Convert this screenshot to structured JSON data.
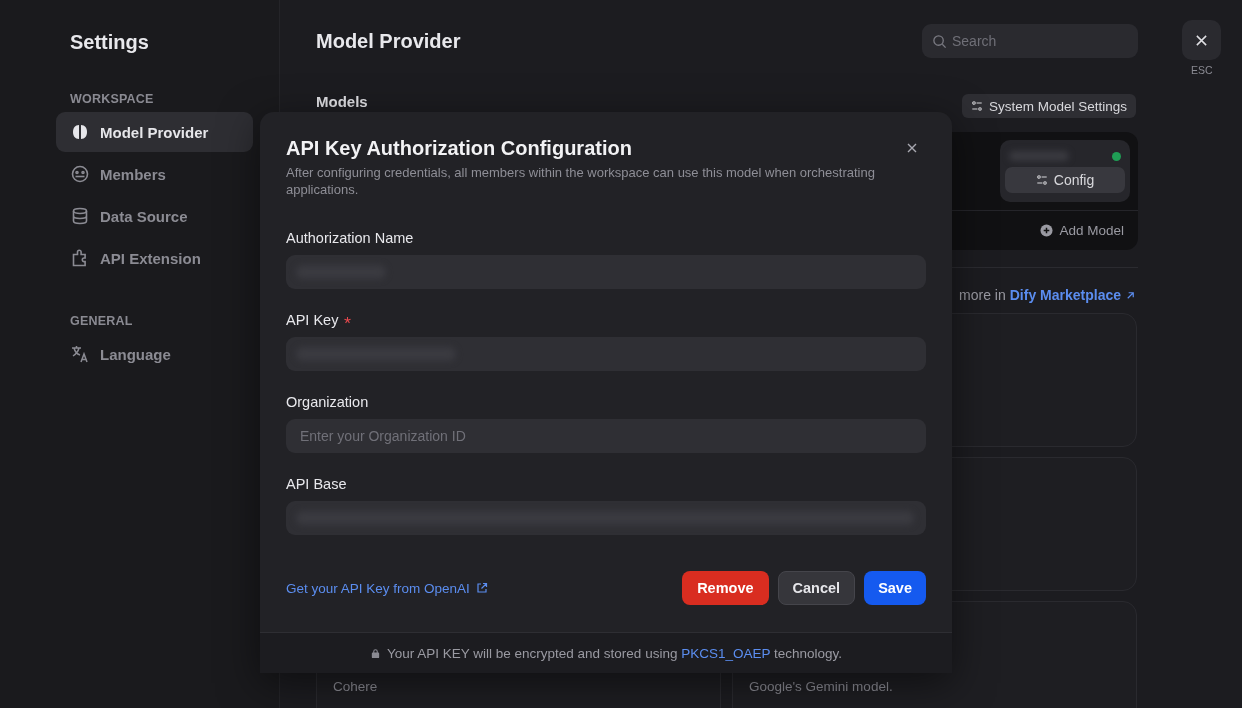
{
  "sidebar": {
    "title": "Settings",
    "sections": [
      {
        "heading": "WORKSPACE",
        "items": [
          {
            "label": "Model Provider",
            "selected": true
          },
          {
            "label": "Members",
            "selected": false
          },
          {
            "label": "Data Source",
            "selected": false
          },
          {
            "label": "API Extension",
            "selected": false
          }
        ]
      },
      {
        "heading": "GENERAL",
        "items": [
          {
            "label": "Language",
            "selected": false
          }
        ]
      }
    ]
  },
  "header": {
    "title": "Model Provider",
    "search": {
      "placeholder": "Search"
    },
    "close_hint": "ESC"
  },
  "models": {
    "heading": "Models",
    "system_button": "System Model Settings",
    "config_button": "Config",
    "add_model_button": "Add Model"
  },
  "marketplace": {
    "text": "more in",
    "link": "Dify Marketplace"
  },
  "provider_cards": [
    {
      "description": "Cohere"
    },
    {
      "description": "Google's Gemini model."
    }
  ],
  "dialog": {
    "title": "API Key Authorization Configuration",
    "description": "After configuring credentials, all members within the workspace can use this model when orchestrating applications.",
    "fields": [
      {
        "label": "Authorization Name",
        "required": false,
        "redacted": true
      },
      {
        "label": "API Key",
        "required": true,
        "redacted": true
      },
      {
        "label": "Organization",
        "required": false,
        "redacted": false,
        "placeholder": "Enter your Organization ID"
      },
      {
        "label": "API Base",
        "required": false,
        "redacted": true
      }
    ],
    "help_link": "Get your API Key from OpenAI",
    "buttons": [
      {
        "label": "Remove",
        "kind": "danger"
      },
      {
        "label": "Cancel",
        "kind": "secondary"
      },
      {
        "label": "Save",
        "kind": "primary"
      }
    ],
    "footer": {
      "before": "Your API KEY will be encrypted and stored using",
      "link": "PKCS1_OAEP",
      "after": "technology."
    }
  }
}
